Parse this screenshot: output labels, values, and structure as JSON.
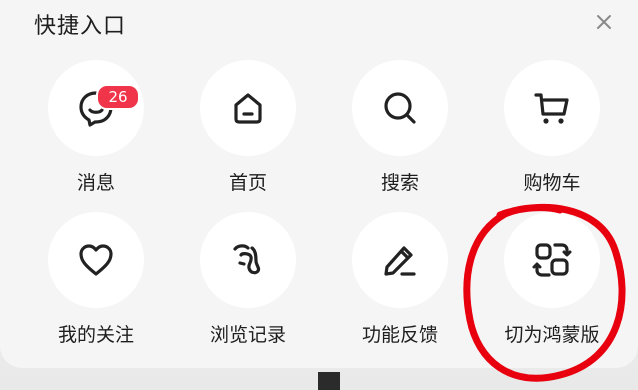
{
  "header": {
    "title": "快捷入口",
    "close_icon": "close-icon"
  },
  "colors": {
    "panel_bg": "#f5f5f5",
    "circle_bg": "#ffffff",
    "badge_bg": "#f0354a",
    "annotation": "#e8000f"
  },
  "items": [
    {
      "label": "消息",
      "icon": "message-icon",
      "badge": "26"
    },
    {
      "label": "首页",
      "icon": "home-icon"
    },
    {
      "label": "搜索",
      "icon": "search-icon"
    },
    {
      "label": "购物车",
      "icon": "cart-icon"
    },
    {
      "label": "我的关注",
      "icon": "heart-icon"
    },
    {
      "label": "浏览记录",
      "icon": "footprint-icon"
    },
    {
      "label": "功能反馈",
      "icon": "pencil-icon"
    },
    {
      "label": "切为鸿蒙版",
      "icon": "switch-icon"
    }
  ]
}
